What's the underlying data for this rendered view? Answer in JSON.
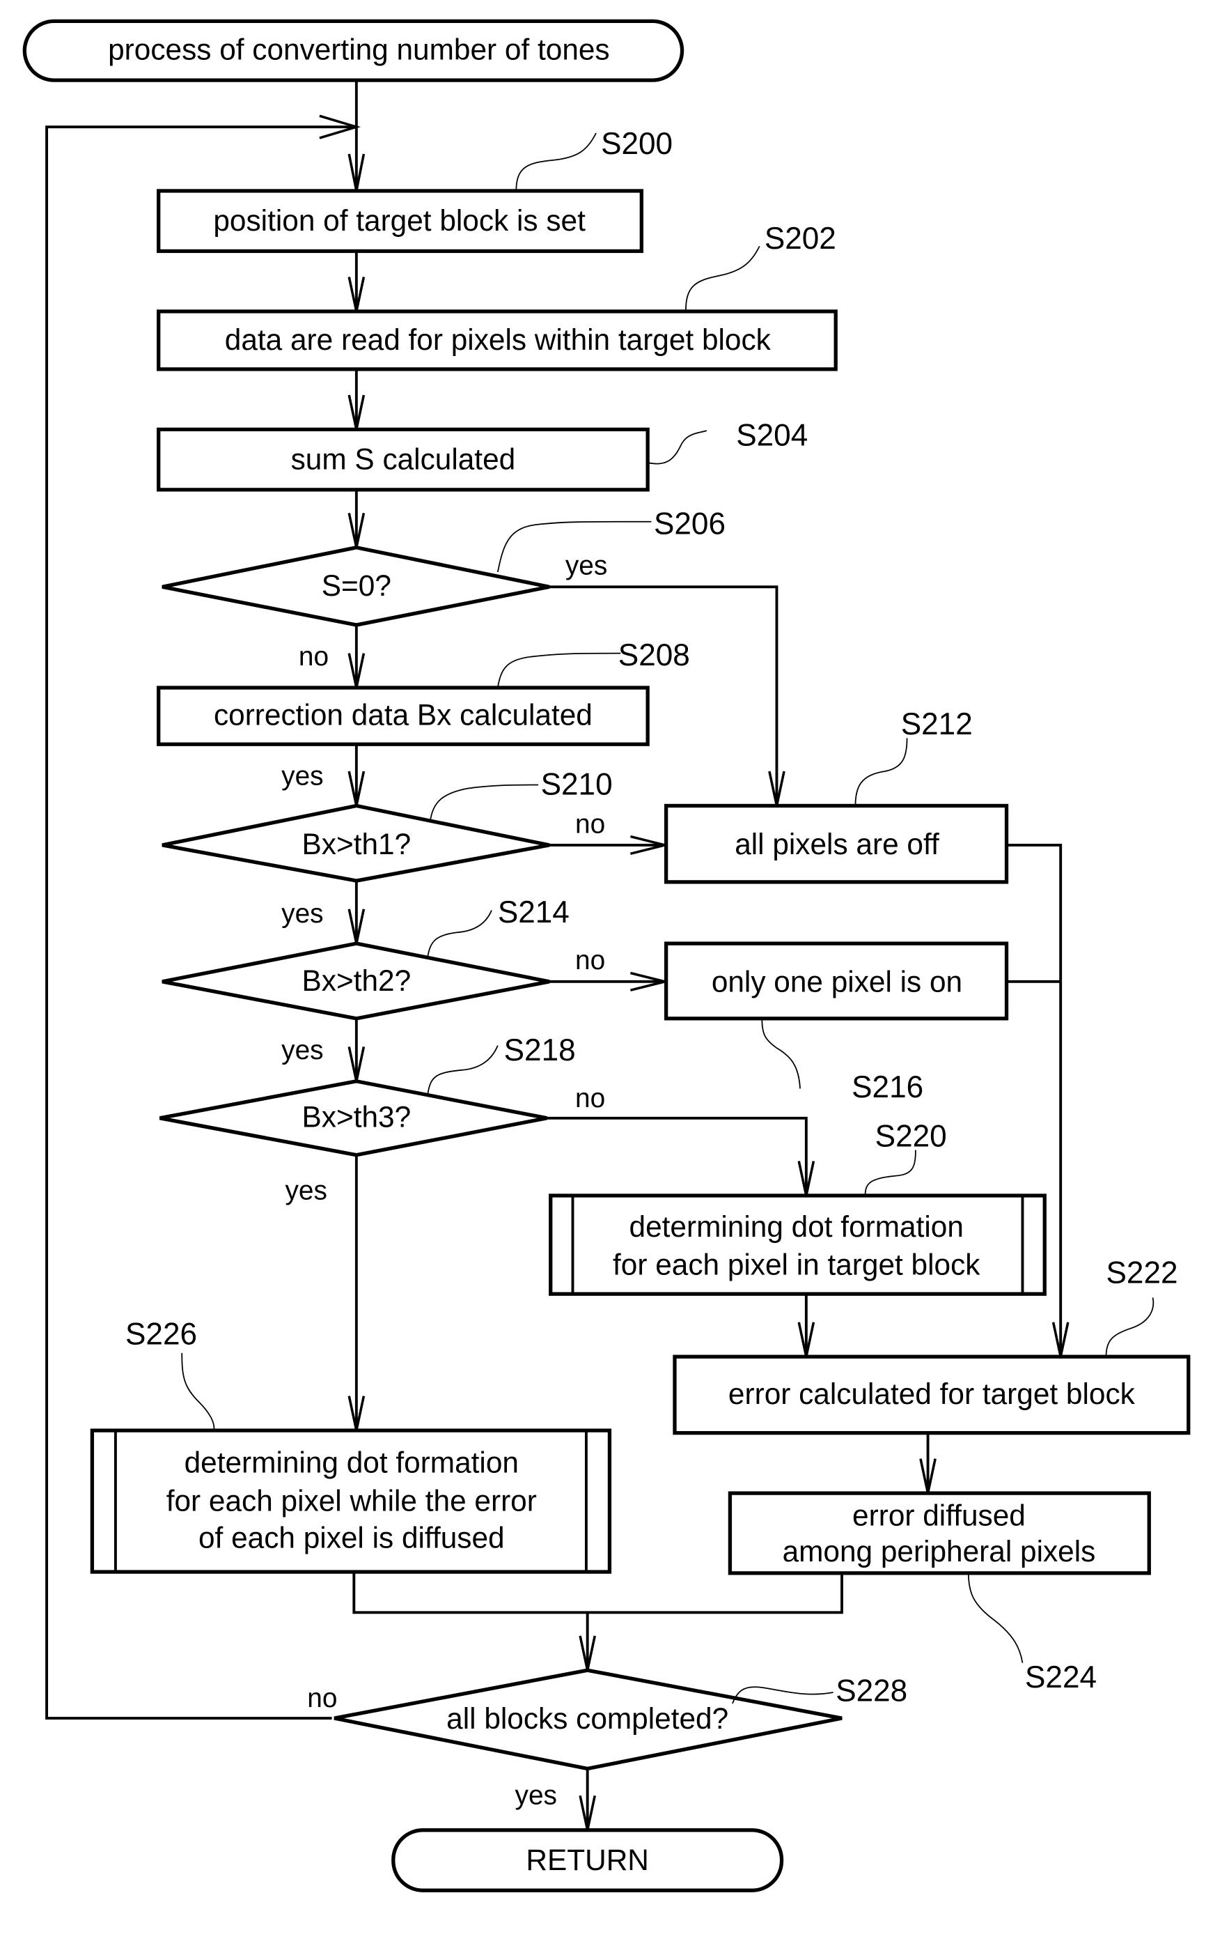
{
  "diagram": {
    "type": "flowchart",
    "start": "process of converting number of tones",
    "end": "RETURN",
    "steps": {
      "s200": {
        "id": "S200",
        "text": "position of target block is set"
      },
      "s202": {
        "id": "S202",
        "text": "data are read for pixels within target block"
      },
      "s204": {
        "id": "S204",
        "text": "sum S calculated"
      },
      "s206": {
        "id": "S206",
        "text": "S=0?"
      },
      "s208": {
        "id": "S208",
        "text": "correction data Bx calculated"
      },
      "s210": {
        "id": "S210",
        "text": "Bx>th1?"
      },
      "s212": {
        "id": "S212",
        "text": "all pixels are off"
      },
      "s214": {
        "id": "S214",
        "text": "Bx>th2?"
      },
      "s216": {
        "id": "S216",
        "text": "only one pixel is on"
      },
      "s218": {
        "id": "S218",
        "text": "Bx>th3?"
      },
      "s220": {
        "id": "S220",
        "lines": [
          "determining dot formation",
          "for each pixel in target block"
        ]
      },
      "s222": {
        "id": "S222",
        "text": "error calculated for target block"
      },
      "s224": {
        "id": "S224",
        "lines": [
          "error diffused",
          "among peripheral pixels"
        ]
      },
      "s226": {
        "id": "S226",
        "lines": [
          "determining dot formation",
          "for each pixel while the error",
          "of each pixel is diffused"
        ]
      },
      "s228": {
        "id": "S228",
        "text": "all blocks completed?"
      }
    },
    "branch_labels": {
      "yes": "yes",
      "no": "no"
    }
  }
}
